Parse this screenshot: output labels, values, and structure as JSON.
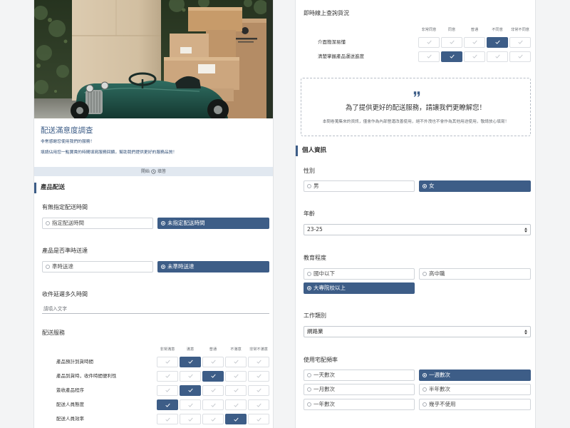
{
  "colors": {
    "accent": "#3d5d87",
    "start_bar": "#e1e8f0",
    "page_background": "#f3f4f5"
  },
  "intro": {
    "title": "配送滿意度調查",
    "thanks": "非常感謝您使用我們的服務！",
    "request": "填請佔用您一點寶貴的時間填寫服務回饋，幫助我們提供更好的服務品質！",
    "start": {
      "before": "開始",
      "icon": "clock-icon",
      "after": "填答"
    }
  },
  "delivery": {
    "title": "產品配送",
    "time_specified": {
      "label": "有無指定配送時間",
      "options": [
        {
          "label": "指定配送時間",
          "selected": false
        },
        {
          "label": "未指定配送時間",
          "selected": true
        }
      ]
    },
    "on_time": {
      "label": "產品是否準時送達",
      "options": [
        {
          "label": "準時送達",
          "selected": false
        },
        {
          "label": "未準時送達",
          "selected": true
        }
      ]
    },
    "delay": {
      "label": "收件延遲多久時間",
      "placeholder": "請填入文字"
    },
    "service": {
      "label": "配送服務",
      "scale": [
        "非常滿意",
        "滿意",
        "普通",
        "不滿意",
        "非常不滿意"
      ],
      "rows": [
        {
          "label": "產品預計到貨時間",
          "selected": 1
        },
        {
          "label": "產品到貨時，收件時間便利性",
          "selected": 2
        },
        {
          "label": "簽收產品程序",
          "selected": 1
        },
        {
          "label": "配送人員態度",
          "selected": 0
        },
        {
          "label": "配送人員效率",
          "selected": 3
        }
      ]
    }
  },
  "tracking": {
    "label": "即時線上查詢貨況",
    "scale": [
      "非常同意",
      "同意",
      "普通",
      "不同意",
      "非常不同意"
    ],
    "rows": [
      {
        "label": "介面簡潔易懂",
        "selected": 3
      },
      {
        "label": "清楚掌握產品運送進度",
        "selected": 1
      }
    ]
  },
  "notice": {
    "icon": "quote-icon",
    "headline": "為了提供更好的配送服務，請讓我們更瞭解您！",
    "body": "本問卷蒐集來的資訊，僅會作為內部營運改善使用，絕不外洩也不會作為其他用途使用，敬請放心填寫！"
  },
  "personal": {
    "title": "個人資訊",
    "gender": {
      "label": "性別",
      "options": [
        {
          "label": "男",
          "selected": false
        },
        {
          "label": "女",
          "selected": true
        }
      ]
    },
    "age": {
      "label": "年齡",
      "value": "23-25"
    },
    "education": {
      "label": "教育程度",
      "options": [
        {
          "label": "國中以下",
          "selected": false
        },
        {
          "label": "高中職",
          "selected": false
        },
        {
          "label": "大專院校以上",
          "selected": true
        }
      ]
    },
    "occupation": {
      "label": "工作類別",
      "value": "網路業"
    },
    "frequency": {
      "label": "使用宅配頻率",
      "options": [
        {
          "label": "一天數次",
          "selected": false
        },
        {
          "label": "一週數次",
          "selected": true
        },
        {
          "label": "一月數次",
          "selected": false
        },
        {
          "label": "半年數次",
          "selected": false
        },
        {
          "label": "一年數次",
          "selected": false
        },
        {
          "label": "幾乎不使用",
          "selected": false
        }
      ]
    }
  }
}
